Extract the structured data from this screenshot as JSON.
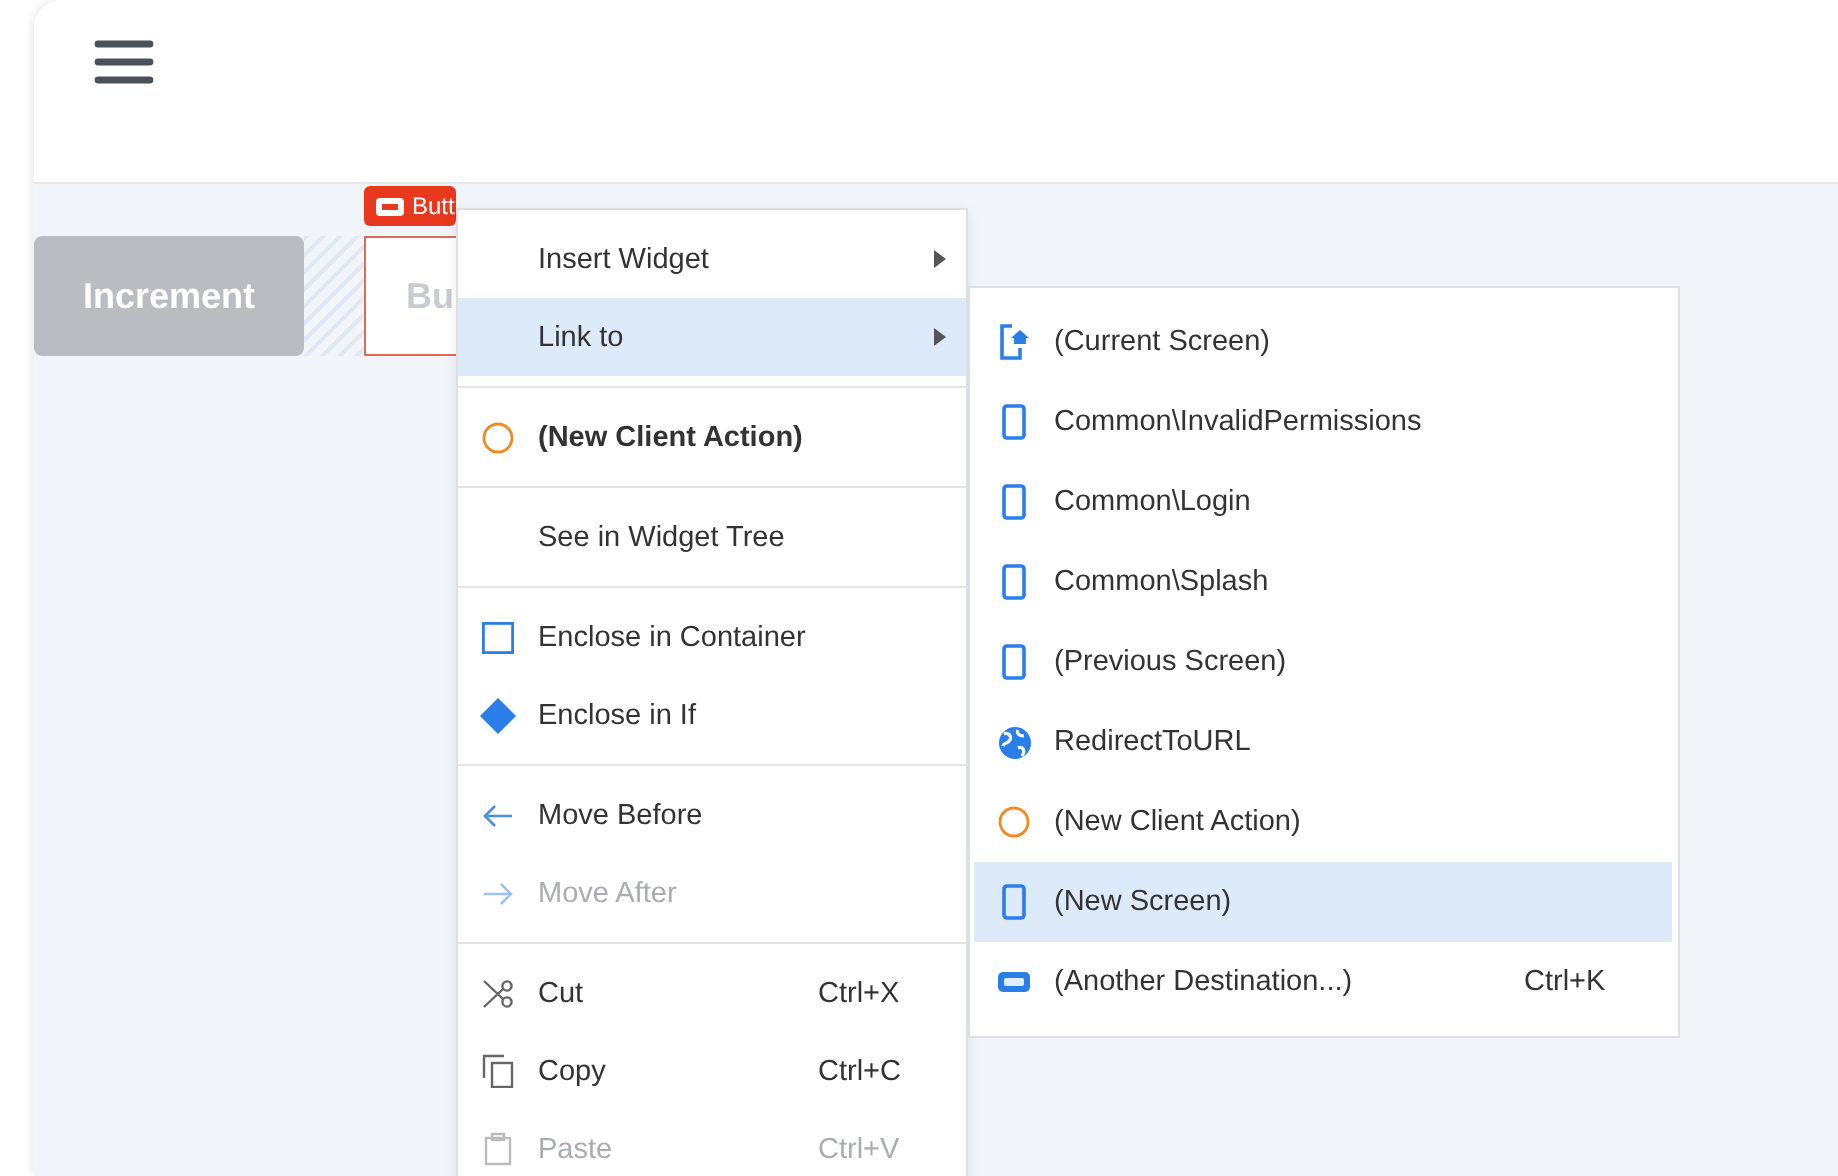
{
  "canvas": {
    "widgets": [
      {
        "kind": "button",
        "label": "Increment",
        "selected": false
      },
      {
        "kind": "spacer"
      },
      {
        "kind": "button",
        "label": "Bu",
        "selected": true,
        "badge": "Butt"
      }
    ]
  },
  "context_menu": {
    "sections": [
      [
        {
          "label": "Insert Widget",
          "kind": "plain",
          "submenu": true,
          "selected": false,
          "disabled": false,
          "emphasized": false
        },
        {
          "label": "Link to",
          "kind": "plain",
          "submenu": true,
          "selected": true,
          "disabled": false,
          "emphasized": false
        }
      ],
      [
        {
          "label": "(New Client Action)",
          "kind": "client-action",
          "submenu": false,
          "selected": false,
          "disabled": false,
          "emphasized": true
        }
      ],
      [
        {
          "label": "See in Widget Tree",
          "kind": "plain",
          "submenu": false,
          "selected": false,
          "disabled": false,
          "emphasized": false
        }
      ],
      [
        {
          "label": "Enclose in Container",
          "kind": "container",
          "submenu": false,
          "selected": false,
          "disabled": false,
          "emphasized": false
        },
        {
          "label": "Enclose in If",
          "kind": "if",
          "submenu": false,
          "selected": false,
          "disabled": false,
          "emphasized": false
        }
      ],
      [
        {
          "label": "Move Before",
          "kind": "move-before",
          "submenu": false,
          "selected": false,
          "disabled": false,
          "emphasized": false
        },
        {
          "label": "Move After",
          "kind": "move-after",
          "submenu": false,
          "selected": false,
          "disabled": true,
          "emphasized": false
        }
      ],
      [
        {
          "label": "Cut",
          "kind": "cut",
          "shortcut": "Ctrl+X",
          "submenu": false,
          "selected": false,
          "disabled": false,
          "emphasized": false
        },
        {
          "label": "Copy",
          "kind": "copy",
          "shortcut": "Ctrl+C",
          "submenu": false,
          "selected": false,
          "disabled": false,
          "emphasized": false
        },
        {
          "label": "Paste",
          "kind": "paste",
          "shortcut": "Ctrl+V",
          "submenu": false,
          "selected": false,
          "disabled": true,
          "emphasized": false
        }
      ]
    ]
  },
  "submenu": {
    "items": [
      {
        "label": "(Current Screen)",
        "kind": "current-screen",
        "selected": false
      },
      {
        "label": "Common\\InvalidPermissions",
        "kind": "screen",
        "selected": false
      },
      {
        "label": "Common\\Login",
        "kind": "screen",
        "selected": false
      },
      {
        "label": "Common\\Splash",
        "kind": "screen",
        "selected": false
      },
      {
        "label": "(Previous Screen)",
        "kind": "screen",
        "selected": false
      },
      {
        "label": "RedirectToURL",
        "kind": "url",
        "selected": false
      },
      {
        "label": "(New Client Action)",
        "kind": "client-action",
        "selected": false
      },
      {
        "label": "(New Screen)",
        "kind": "screen",
        "selected": true
      },
      {
        "label": "(Another Destination...)",
        "kind": "destination",
        "shortcut": "Ctrl+K",
        "selected": false
      }
    ]
  }
}
